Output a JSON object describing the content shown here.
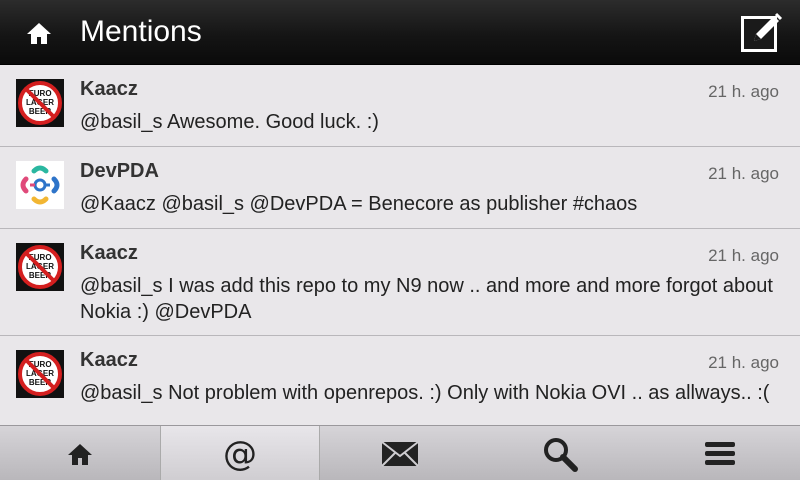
{
  "header": {
    "title": "Mentions",
    "home_icon": "home-icon",
    "compose_icon": "compose-icon"
  },
  "mentions": [
    {
      "author": "Kaacz",
      "time": "21 h. ago",
      "text": "@basil_s Awesome. Good luck. :)",
      "avatar": "euro-lager-beer-avatar",
      "avatar_text": [
        "EURO",
        "LAGER",
        "BEER"
      ]
    },
    {
      "author": "DevPDA",
      "time": "21 h. ago",
      "text": "@Kaacz @basil_s @DevPDA = Benecore as publisher #chaos",
      "avatar": "devpda-logo-avatar"
    },
    {
      "author": "Kaacz",
      "time": "21 h. ago",
      "text": "@basil_s I was add this repo to my N9 now .. and more and more forgot about Nokia :)  @DevPDA",
      "avatar": "euro-lager-beer-avatar",
      "avatar_text": [
        "EURO",
        "LAGER",
        "BEER"
      ]
    },
    {
      "author": "Kaacz",
      "time": "21 h. ago",
      "text": "@basil_s Not problem with openrepos. :) Only with Nokia OVI .. as allways.. :(",
      "avatar": "euro-lager-beer-avatar",
      "avatar_text": [
        "EURO",
        "LAGER",
        "BEER"
      ]
    }
  ],
  "toolbar": {
    "items": [
      {
        "name": "home",
        "icon": "home-icon"
      },
      {
        "name": "mentions",
        "icon": "at-icon",
        "glyph": "@",
        "active": true
      },
      {
        "name": "messages",
        "icon": "envelope-icon"
      },
      {
        "name": "search",
        "icon": "search-icon"
      },
      {
        "name": "menu",
        "icon": "menu-icon"
      }
    ]
  },
  "colors": {
    "header_bg": "#151515",
    "list_bg": "#e9e7ea",
    "avatar_red": "#d41f1f"
  }
}
